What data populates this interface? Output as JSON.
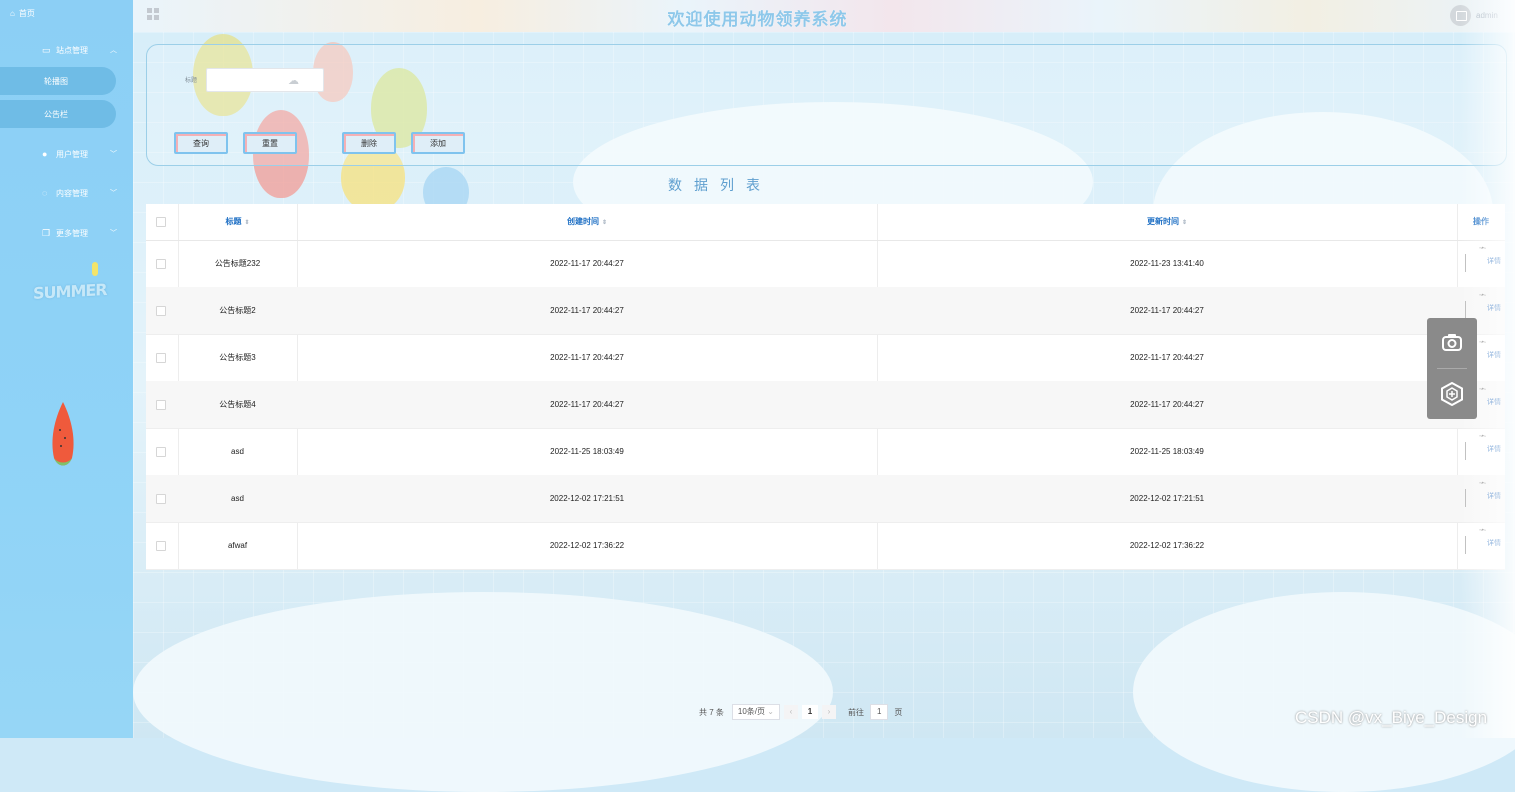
{
  "header": {
    "title": "欢迎使用动物领养系统",
    "user_name": "admin"
  },
  "sidebar": {
    "home_label": "首页",
    "menus": [
      {
        "label": "站点管理",
        "icon": "monitor-icon",
        "expanded": true,
        "children": [
          {
            "label": "轮播图"
          },
          {
            "label": "公告栏"
          }
        ]
      },
      {
        "label": "用户管理",
        "icon": "user-icon",
        "expanded": false
      },
      {
        "label": "内容管理",
        "icon": "chat-icon",
        "expanded": false
      },
      {
        "label": "更多管理",
        "icon": "copy-icon",
        "expanded": false
      }
    ],
    "decoration_text": "SUMMER"
  },
  "search": {
    "title_label": "标题",
    "title_value": "",
    "buttons": {
      "query": "查询",
      "reset": "重置",
      "delete": "删除",
      "add": "添加"
    }
  },
  "list_title": "数据列表",
  "table": {
    "columns": [
      "标题",
      "创建时间",
      "更新时间",
      "操作"
    ],
    "rows": [
      {
        "title": "公告标题232",
        "created": "2022-11-17 20:44:27",
        "updated": "2022-11-23 13:41:40"
      },
      {
        "title": "公告标题2",
        "created": "2022-11-17 20:44:27",
        "updated": "2022-11-17 20:44:27"
      },
      {
        "title": "公告标题3",
        "created": "2022-11-17 20:44:27",
        "updated": "2022-11-17 20:44:27"
      },
      {
        "title": "公告标题4",
        "created": "2022-11-17 20:44:27",
        "updated": "2022-11-17 20:44:27"
      },
      {
        "title": "asd",
        "created": "2022-11-25 18:03:49",
        "updated": "2022-11-25 18:03:49"
      },
      {
        "title": "asd",
        "created": "2022-12-02 17:21:51",
        "updated": "2022-12-02 17:21:51"
      },
      {
        "title": "afwaf",
        "created": "2022-12-02 17:36:22",
        "updated": "2022-12-02 17:36:22"
      }
    ],
    "detail_label": "详情"
  },
  "pagination": {
    "total": "共 7 条",
    "page_size": "10条/页",
    "current_page": "1",
    "goto_label": "前往",
    "goto_value": "1",
    "page_unit": "页"
  },
  "watermark": "CSDN @vx_Biye_Design"
}
